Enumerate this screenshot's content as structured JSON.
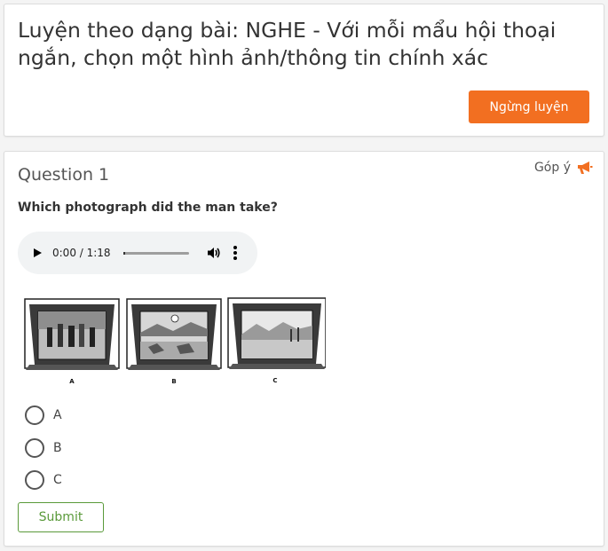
{
  "header": {
    "title": "Luyện theo dạng bài: NGHE - Với mỗi mẩu hội thoại ngắn, chọn một hình ảnh/thông tin chính xác",
    "stop_label": "Ngừng luyện"
  },
  "question": {
    "title": "Question 1",
    "feedback_label": "Góp ý",
    "prompt": "Which photograph did the man take?",
    "audio": {
      "time": "0:00 / 1:18",
      "progress": 0
    },
    "photos": {
      "labels": [
        "A",
        "B",
        "C"
      ]
    },
    "options": [
      {
        "label": "A"
      },
      {
        "label": "B"
      },
      {
        "label": "C"
      }
    ],
    "submit_label": "Submit"
  },
  "colors": {
    "accent": "#f26f21",
    "submit": "#5a9a3a"
  },
  "icons": {
    "feedback": "megaphone-icon",
    "play": "play-icon",
    "volume": "volume-icon",
    "more": "more-vertical-icon"
  }
}
